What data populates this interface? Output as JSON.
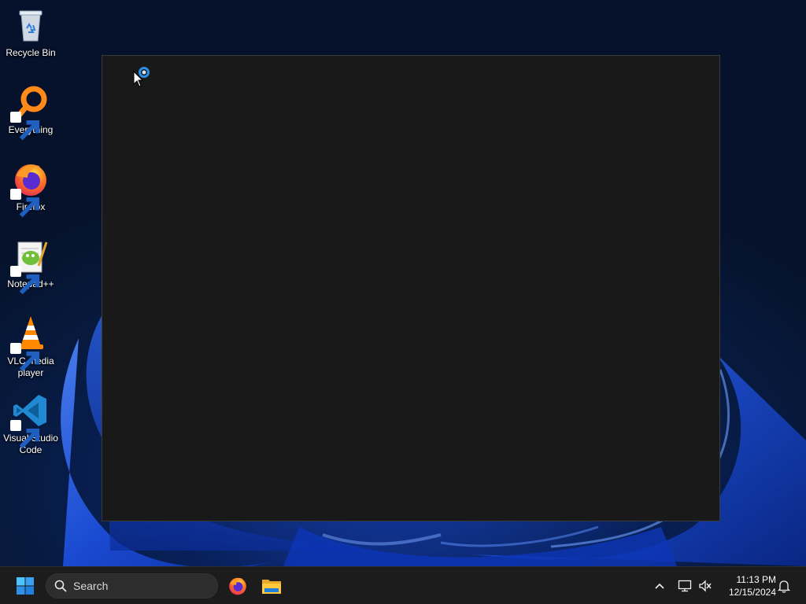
{
  "desktop": {
    "icons": [
      {
        "label": "Recycle Bin",
        "icon": "recycle-bin-icon",
        "shortcut": false
      },
      {
        "label": "Everything",
        "icon": "everything-search-icon",
        "shortcut": true
      },
      {
        "label": "Firefox",
        "icon": "firefox-icon",
        "shortcut": true
      },
      {
        "label": "Notepad++",
        "icon": "notepad-plus-plus-icon",
        "shortcut": true
      },
      {
        "label": "VLC media player",
        "icon": "vlc-cone-icon",
        "shortcut": true
      },
      {
        "label": "Visual Studio Code",
        "icon": "vscode-icon",
        "shortcut": true
      }
    ]
  },
  "window": {
    "state": "loading",
    "background": "#191919",
    "cursor": "busy-cursor"
  },
  "taskbar": {
    "search_placeholder": "Search",
    "pinned": [
      {
        "name": "Firefox",
        "icon": "firefox-icon"
      },
      {
        "name": "File Explorer",
        "icon": "folder-icon"
      }
    ],
    "tray": {
      "chevron": "chevron-up-icon",
      "network": "network-icon",
      "volume": "volume-muted-icon",
      "notifications": "bell-icon"
    },
    "clock": {
      "time": "11:13 PM",
      "date": "12/15/2024"
    }
  },
  "colors": {
    "accent": "#0078d4",
    "taskbar": "#1c1c1c",
    "wallpaper_bloom": "#1f55e8"
  }
}
